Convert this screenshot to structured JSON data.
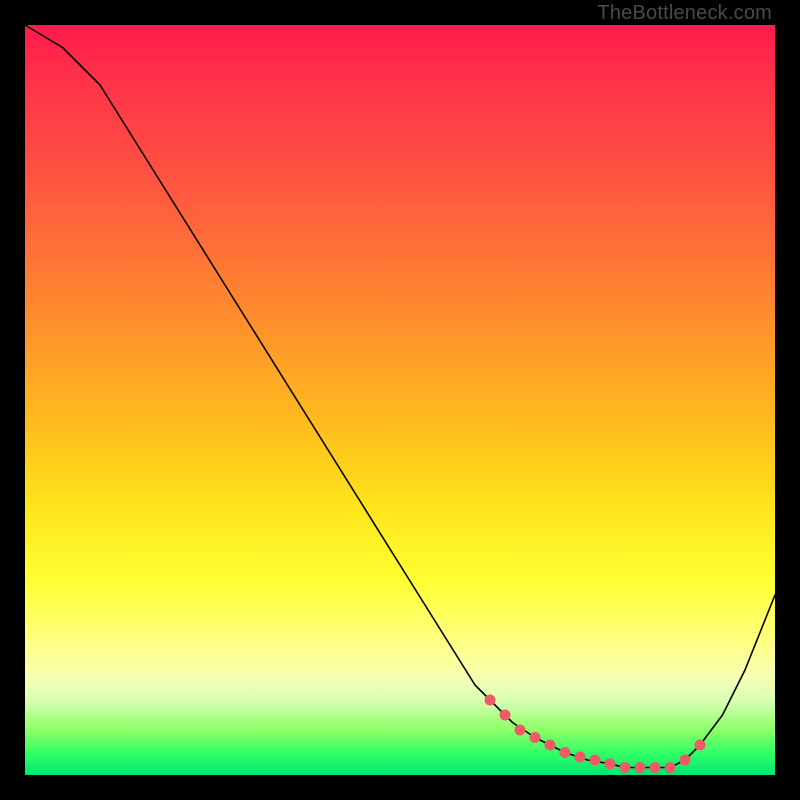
{
  "watermark": "TheBottleneck.com",
  "colors": {
    "curve": "#000000",
    "marker": "#ef5a66"
  },
  "chart_data": {
    "type": "line",
    "title": "",
    "xlabel": "",
    "ylabel": "",
    "xlim": [
      0,
      100
    ],
    "ylim": [
      0,
      100
    ],
    "grid": false,
    "legend": false,
    "series": [
      {
        "name": "bottleneck-curve",
        "x": [
          0,
          5,
          10,
          15,
          20,
          25,
          30,
          35,
          40,
          45,
          50,
          55,
          60,
          62,
          65,
          68,
          70,
          72,
          75,
          78,
          80,
          82,
          84,
          86,
          88,
          90,
          93,
          96,
          100
        ],
        "y": [
          100,
          97,
          92,
          84,
          76,
          68,
          60,
          52,
          44,
          36,
          28,
          20,
          12,
          10,
          7,
          5,
          4,
          3,
          2,
          1.5,
          1,
          1,
          1,
          1,
          2,
          4,
          8,
          14,
          24
        ]
      }
    ],
    "markers": {
      "name": "highlight-range",
      "x": [
        62,
        64,
        66,
        68,
        70,
        72,
        74,
        76,
        78,
        80,
        82,
        84,
        86,
        88,
        90
      ],
      "y": [
        10,
        8,
        6,
        5,
        4,
        3,
        2.4,
        2,
        1.5,
        1,
        1,
        1,
        1,
        2,
        4
      ]
    }
  }
}
